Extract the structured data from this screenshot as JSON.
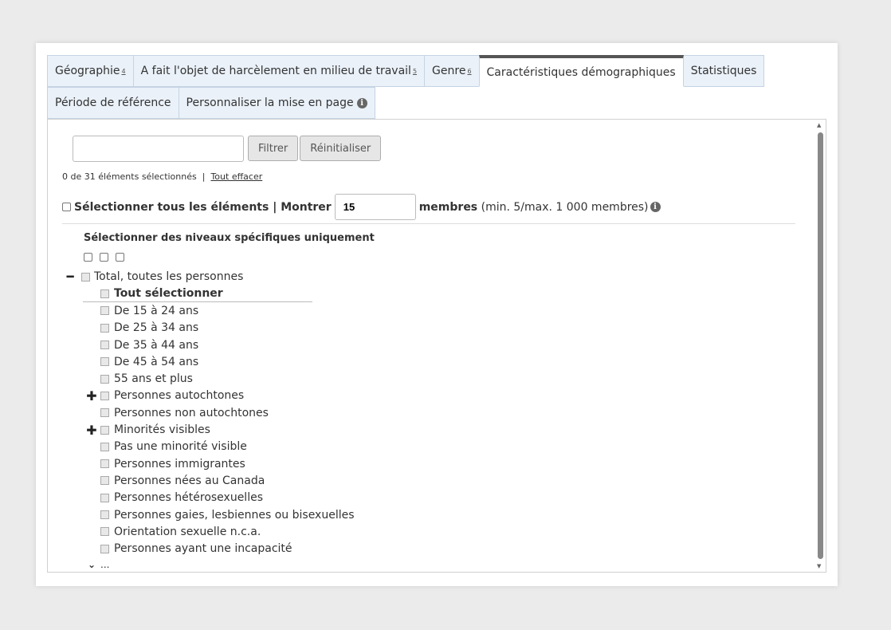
{
  "tabs_row1": [
    {
      "label": "Géographie",
      "note": "4",
      "active": false
    },
    {
      "label": "A fait l'objet de harcèlement en milieu de travail",
      "note": "5",
      "active": false
    },
    {
      "label": "Genre",
      "note": "6",
      "active": false
    },
    {
      "label": "Caractéristiques démographiques",
      "note": "",
      "active": true
    },
    {
      "label": "Statistiques",
      "note": "",
      "active": false
    }
  ],
  "tabs_row2": [
    {
      "label": "Période de référence"
    },
    {
      "label": "Personnaliser la mise en page",
      "info_icon": "info-icon"
    }
  ],
  "filter": {
    "input_value": "",
    "filter_label": "Filtrer",
    "reset_label": "Réinitialiser"
  },
  "selection_count": "0 de 31 éléments sélectionnés",
  "separator": "|",
  "clear_all_label": "Tout effacer",
  "select_all_label": "Sélectionner tous les éléments | Montrer",
  "members_value": "15",
  "members_label": "membres",
  "members_hint": "(min. 5/max. 1 000 membres)",
  "levels_heading": "Sélectionner des niveaux spécifiques uniquement",
  "tree": {
    "root_label": "Total, toutes les personnes",
    "select_all_label": "Tout sélectionner",
    "items": [
      {
        "label": "De 15 à 24 ans",
        "expandable": false
      },
      {
        "label": "De 25 à 34 ans",
        "expandable": false
      },
      {
        "label": "De 35 à 44 ans",
        "expandable": false
      },
      {
        "label": "De 45 à 54 ans",
        "expandable": false
      },
      {
        "label": "55 ans et plus",
        "expandable": false
      },
      {
        "label": "Personnes autochtones",
        "expandable": true
      },
      {
        "label": "Personnes non autochtones",
        "expandable": false
      },
      {
        "label": "Minorités visibles",
        "expandable": true
      },
      {
        "label": "Pas une minorité visible",
        "expandable": false
      },
      {
        "label": "Personnes immigrantes",
        "expandable": false
      },
      {
        "label": "Personnes nées au Canada",
        "expandable": false
      },
      {
        "label": "Personnes hétérosexuelles",
        "expandable": false
      },
      {
        "label": "Personnes gaies, lesbiennes ou bisexuelles",
        "expandable": false
      },
      {
        "label": "Orientation sexuelle n.c.a.",
        "expandable": false
      },
      {
        "label": "Personnes ayant une incapacité",
        "expandable": false
      }
    ],
    "more_label": "..."
  }
}
